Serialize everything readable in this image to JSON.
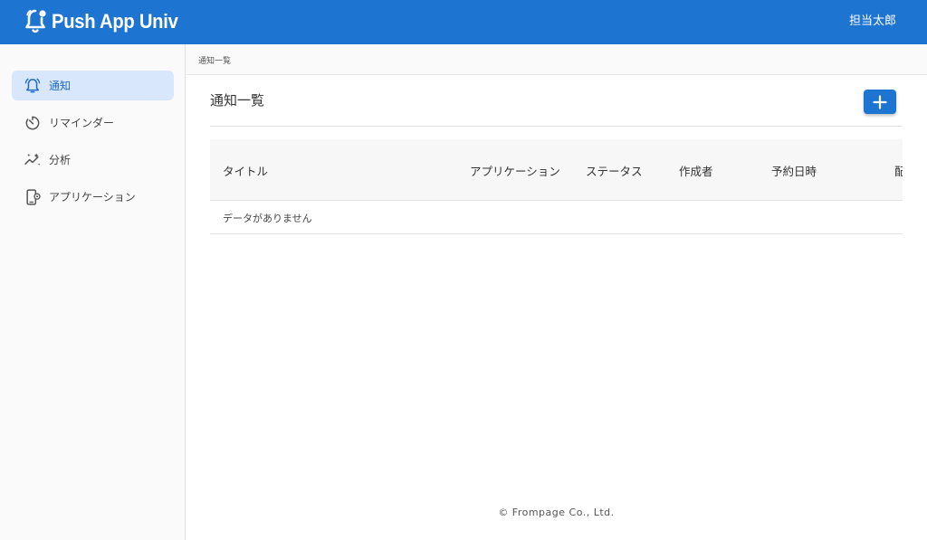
{
  "header": {
    "app_name": "Push App Univ",
    "user_name": "担当太郎",
    "brand_icon": "bell-logo-icon"
  },
  "sidebar": {
    "items": [
      {
        "label": "通知",
        "icon": "bell-icon",
        "active": true
      },
      {
        "label": "リマインダー",
        "icon": "timer-icon",
        "active": false
      },
      {
        "label": "分析",
        "icon": "analytics-icon",
        "active": false
      },
      {
        "label": "アプリケーション",
        "icon": "mobile-settings-icon",
        "active": false
      }
    ]
  },
  "breadcrumb": "通知一覧",
  "main": {
    "title": "通知一覧",
    "add_button_icon": "plus-icon",
    "table": {
      "columns": [
        "タイトル",
        "アプリケーション",
        "ステータス",
        "作成者",
        "予約日時",
        "配"
      ],
      "empty_text": "データがありません"
    }
  },
  "footer": "© Frompage Co., Ltd.",
  "colors": {
    "primary": "#1e74d1",
    "active_nav_bg": "#d8e7fb",
    "active_nav_text": "#1e6bc7"
  }
}
